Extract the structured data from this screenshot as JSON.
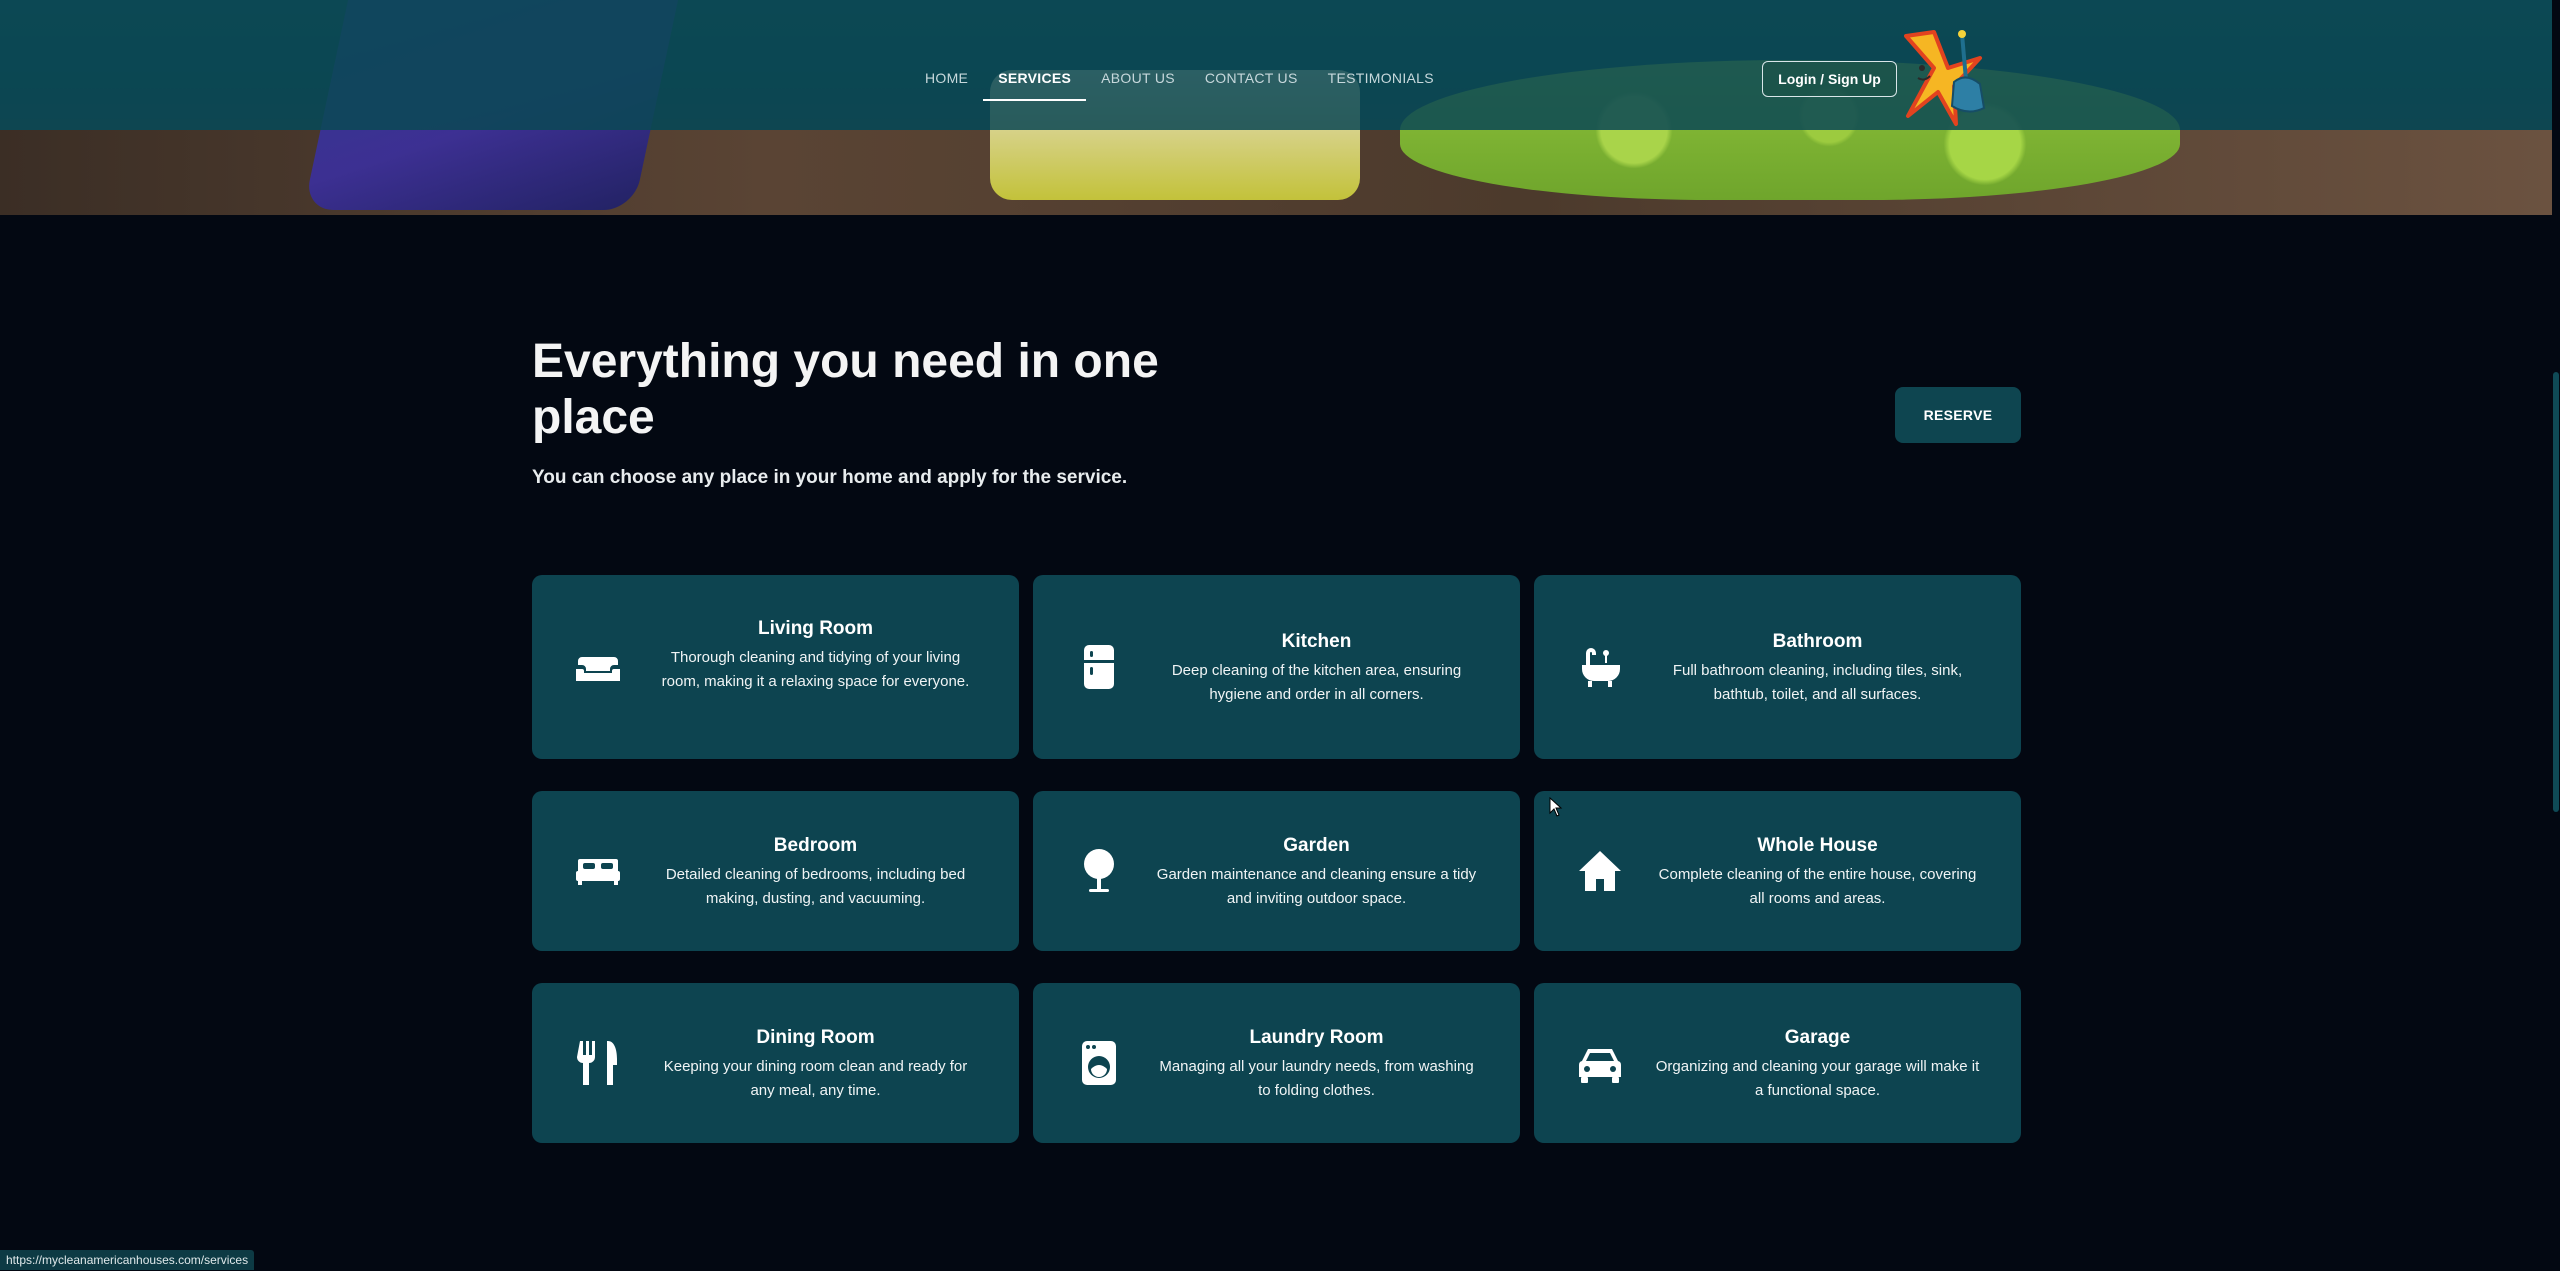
{
  "nav": {
    "links": [
      {
        "label": "HOME"
      },
      {
        "label": "SERVICES"
      },
      {
        "label": "ABOUT US"
      },
      {
        "label": "CONTACT US"
      },
      {
        "label": "TESTIMONIALS"
      }
    ],
    "active": "SERVICES",
    "login_label": "Login / Sign Up"
  },
  "header": {
    "title": "Everything you need in one place",
    "subtitle": "You can choose any place in your home and apply for the service.",
    "reserve_label": "RESERVE"
  },
  "services": [
    {
      "title": "Living Room",
      "desc": "Thorough cleaning and tidying of your living room, making it a relaxing space for everyone.",
      "icon": "sofa-icon"
    },
    {
      "title": "Kitchen",
      "desc": "Deep cleaning of the kitchen area, ensuring hygiene and order in all corners.",
      "icon": "fridge-icon"
    },
    {
      "title": "Bathroom",
      "desc": "Full bathroom cleaning, including tiles, sink, bathtub, toilet, and all surfaces.",
      "icon": "bathtub-icon"
    },
    {
      "title": "Bedroom",
      "desc": "Detailed cleaning of bedrooms, including bed making, dusting, and vacuuming.",
      "icon": "bed-icon"
    },
    {
      "title": "Garden",
      "desc": "Garden maintenance and cleaning ensure a tidy and inviting outdoor space.",
      "icon": "tree-icon"
    },
    {
      "title": "Whole House",
      "desc": "Complete cleaning of the entire house, covering all rooms and areas.",
      "icon": "house-icon"
    },
    {
      "title": "Dining Room",
      "desc": "Keeping your dining room clean and ready for any meal, any time.",
      "icon": "utensils-icon"
    },
    {
      "title": "Laundry Room",
      "desc": "Managing all your laundry needs, from washing to folding clothes.",
      "icon": "washing-machine-icon"
    },
    {
      "title": "Garage",
      "desc": "Organizing and cleaning your garage will make it a functional space.",
      "icon": "car-icon"
    }
  ],
  "status_url": "https://mycleanamericanhouses.com/services",
  "colors": {
    "background": "#030812",
    "card": "#0d4450",
    "nav": "#0c4854"
  }
}
